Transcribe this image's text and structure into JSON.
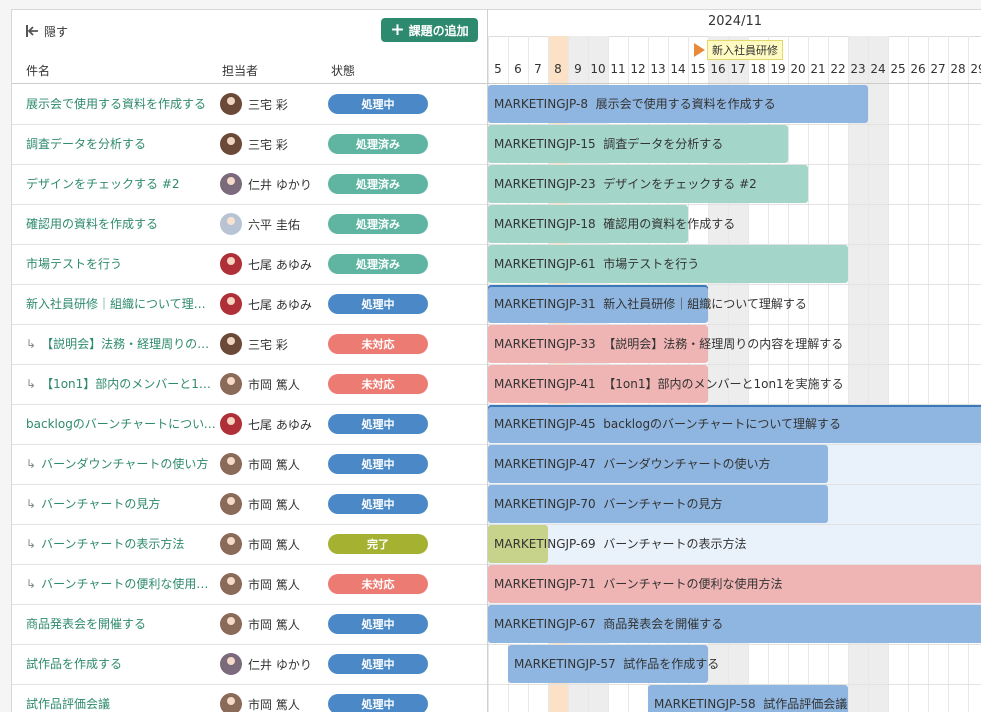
{
  "toolbar": {
    "hide_label": "隠す",
    "add_label": "課題の追加"
  },
  "columns": {
    "title": "件名",
    "assignee": "担当者",
    "status": "状態"
  },
  "gantt": {
    "month": "2024/11",
    "days": [
      "5",
      "6",
      "7",
      "8",
      "9",
      "10",
      "11",
      "12",
      "13",
      "14",
      "15",
      "16",
      "17",
      "18",
      "19",
      "20",
      "21",
      "22",
      "23",
      "24",
      "25",
      "26",
      "27",
      "28",
      "29"
    ],
    "weekend_days": [
      "9",
      "10",
      "16",
      "17",
      "23",
      "24"
    ],
    "today": "8",
    "milestone": {
      "day": "16",
      "label": "新入社員研修"
    }
  },
  "colors": {
    "in_progress": "#4a88c7",
    "resolved": "#5fb5a2",
    "open": "#ec7c73",
    "done": "#a5b130",
    "bar_in_progress": "#8fb6e0",
    "bar_resolved": "#a3d6c8",
    "bar_open": "#efb4b4",
    "bar_done": "#c7d38a"
  },
  "rows": [
    {
      "title": "展示会で使用する資料を作成する",
      "child": false,
      "assignee": "三宅 彩",
      "status": "処理中",
      "status_key": "in_progress",
      "key": "MARKETINGJP-8",
      "gantt_title": "展示会で使用する資料を作成する",
      "start": "5",
      "end": "23"
    },
    {
      "title": "調査データを分析する",
      "child": false,
      "assignee": "三宅 彩",
      "status": "処理済み",
      "status_key": "resolved",
      "key": "MARKETINGJP-15",
      "gantt_title": "調査データを分析する",
      "start": "5",
      "end": "19"
    },
    {
      "title": "デザインをチェックする #2",
      "child": false,
      "assignee": "仁井 ゆかり",
      "status": "処理済み",
      "status_key": "resolved",
      "key": "MARKETINGJP-23",
      "gantt_title": "デザインをチェックする #2",
      "start": "5",
      "end": "20"
    },
    {
      "title": "確認用の資料を作成する",
      "child": false,
      "assignee": "六平 圭佑",
      "status": "処理済み",
      "status_key": "resolved",
      "key": "MARKETINGJP-18",
      "gantt_title": "確認用の資料を作成する",
      "start": "5",
      "end": "14"
    },
    {
      "title": "市場テストを行う",
      "child": false,
      "assignee": "七尾 あゆみ",
      "status": "処理済み",
      "status_key": "resolved",
      "key": "MARKETINGJP-61",
      "gantt_title": "市場テストを行う",
      "start": "5",
      "end": "22"
    },
    {
      "title": "新入社員研修｜組織について理解する",
      "child": false,
      "assignee": "七尾 あゆみ",
      "status": "処理中",
      "status_key": "in_progress",
      "key": "MARKETINGJP-31",
      "gantt_title": "新入社員研修｜組織について理解する",
      "start": "5",
      "end": "15"
    },
    {
      "title": "【説明会】法務・経理周りの内容を理解する",
      "child": true,
      "assignee": "三宅 彩",
      "status": "未対応",
      "status_key": "open",
      "key": "MARKETINGJP-33",
      "gantt_title": "【説明会】法務・経理周りの内容を理解する",
      "start": "5",
      "end": "15"
    },
    {
      "title": "【1on1】部内のメンバーと1on1を実施する",
      "child": true,
      "assignee": "市岡 篤人",
      "status": "未対応",
      "status_key": "open",
      "key": "MARKETINGJP-41",
      "gantt_title": "【1on1】部内のメンバーと1on1を実施する",
      "start": "5",
      "end": "15"
    },
    {
      "title": "backlogのバーンチャートについて理解する",
      "child": false,
      "assignee": "七尾 あゆみ",
      "status": "処理中",
      "status_key": "in_progress",
      "key": "MARKETINGJP-45",
      "gantt_title": "backlogのバーンチャートについて理解する",
      "start": "5",
      "end": "29"
    },
    {
      "title": "バーンダウンチャートの使い方",
      "child": true,
      "assignee": "市岡 篤人",
      "status": "処理中",
      "status_key": "in_progress",
      "key": "MARKETINGJP-47",
      "gantt_title": "バーンダウンチャートの使い方",
      "start": "5",
      "end": "21"
    },
    {
      "title": "バーンチャートの見方",
      "child": true,
      "assignee": "市岡 篤人",
      "status": "処理中",
      "status_key": "in_progress",
      "key": "MARKETINGJP-70",
      "gantt_title": "バーンチャートの見方",
      "start": "5",
      "end": "21"
    },
    {
      "title": "バーンチャートの表示方法",
      "child": true,
      "assignee": "市岡 篤人",
      "status": "完了",
      "status_key": "done",
      "key": "MARKETINGJP-69",
      "gantt_title": "バーンチャートの表示方法",
      "start": "5",
      "end": "7"
    },
    {
      "title": "バーンチャートの便利な使用方法",
      "child": true,
      "assignee": "市岡 篤人",
      "status": "未対応",
      "status_key": "open",
      "key": "MARKETINGJP-71",
      "gantt_title": "バーンチャートの便利な使用方法",
      "start": "5",
      "end": "29"
    },
    {
      "title": "商品発表会を開催する",
      "child": false,
      "assignee": "市岡 篤人",
      "status": "処理中",
      "status_key": "in_progress",
      "key": "MARKETINGJP-67",
      "gantt_title": "商品発表会を開催する",
      "start": "5",
      "end": "29"
    },
    {
      "title": "試作品を作成する",
      "child": false,
      "assignee": "仁井 ゆかり",
      "status": "処理中",
      "status_key": "in_progress",
      "key": "MARKETINGJP-57",
      "gantt_title": "試作品を作成する",
      "start": "6",
      "end": "15"
    },
    {
      "title": "試作品評価会議",
      "child": false,
      "assignee": "市岡 篤人",
      "status": "処理中",
      "status_key": "in_progress",
      "key": "MARKETINGJP-58",
      "gantt_title": "試作品評価会議",
      "start": "13",
      "end": "22"
    }
  ]
}
